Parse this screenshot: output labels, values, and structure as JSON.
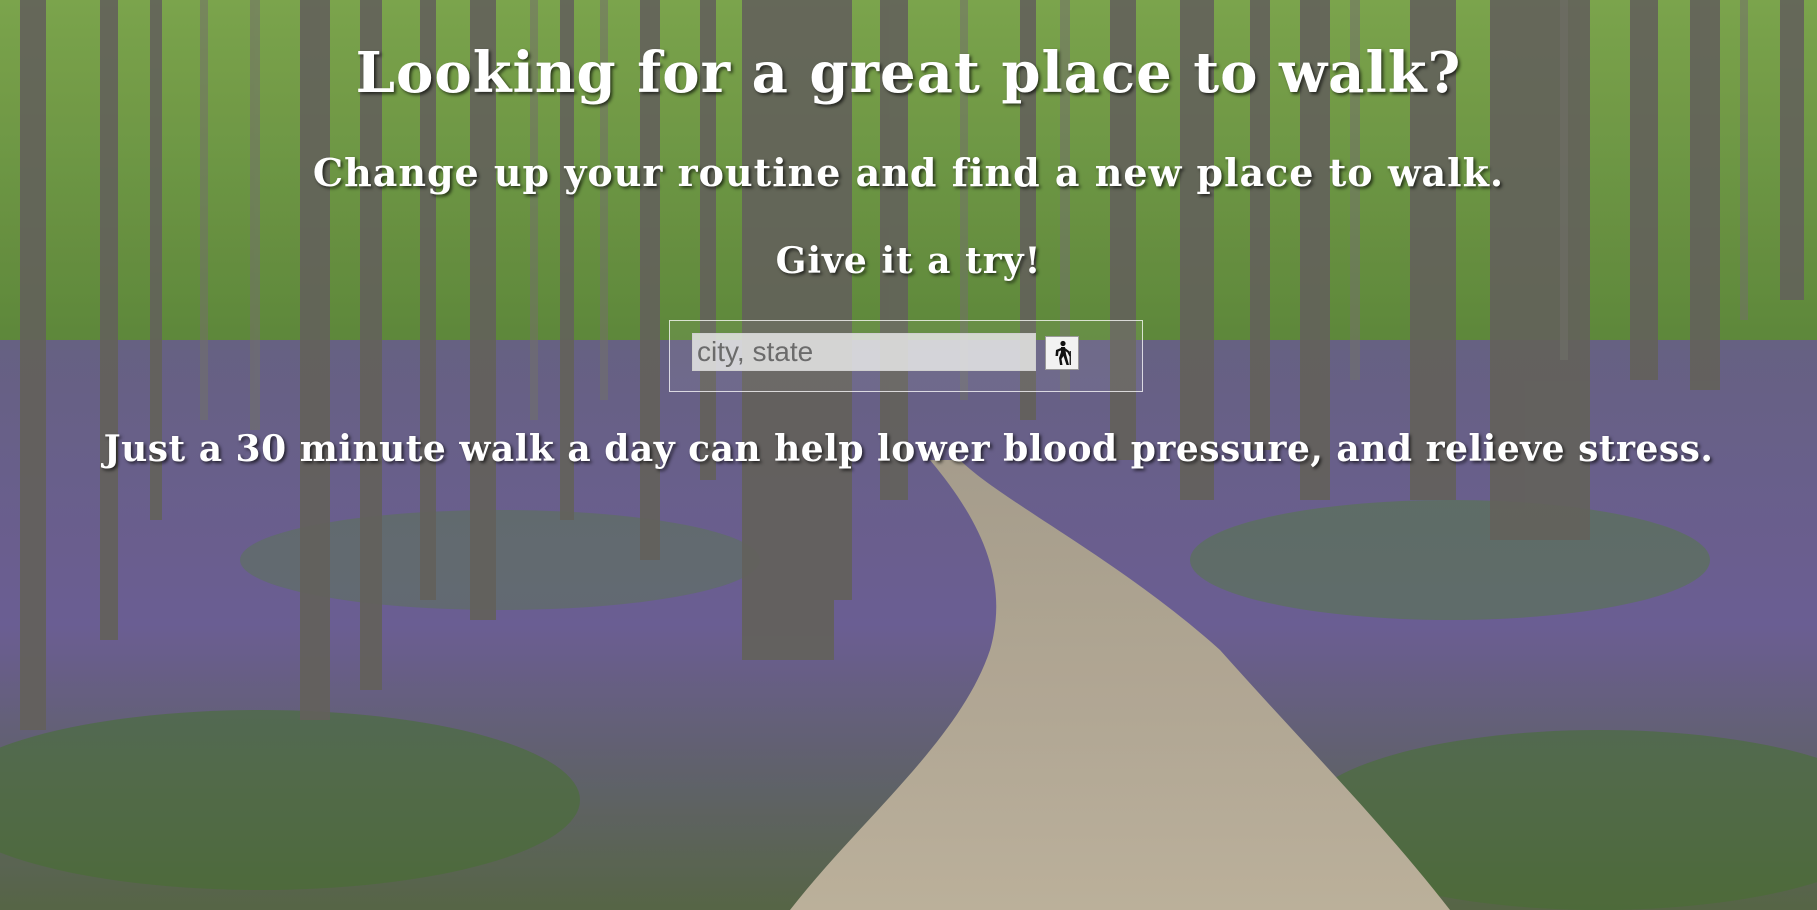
{
  "hero": {
    "title": "Looking for a great place to walk?",
    "subtitle": "Change up your routine and find a new place to walk.",
    "cta": "Give it a try!",
    "fact": "Just a 30 minute walk a day can help lower blood pressure, and relieve stress."
  },
  "search": {
    "placeholder": "city, state",
    "value": "",
    "button_icon": "hiker-icon"
  },
  "colors": {
    "text": "#ffffff",
    "foliage": "#7da650",
    "bluebells": "#7a6fa0",
    "path": "#c9bda4",
    "trunk": "#6e6a64"
  }
}
